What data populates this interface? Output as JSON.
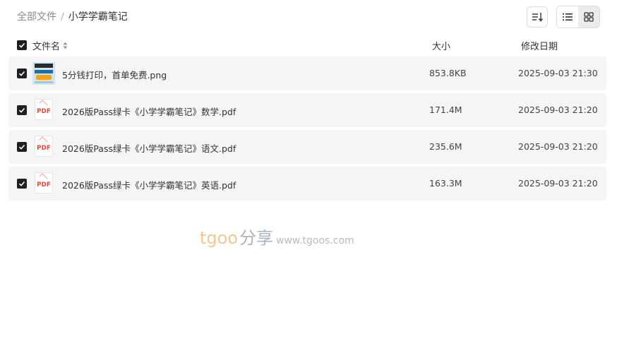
{
  "breadcrumb": {
    "root": "全部文件",
    "separator": "/",
    "current": "小学学霸笔记"
  },
  "toolbar": {
    "sort_icon": "sort-icon",
    "list_view_icon": "list-view-icon",
    "grid_view_icon": "grid-view-icon",
    "active_view": "list"
  },
  "table_header": {
    "name": "文件名",
    "size": "大小",
    "date": "修改日期"
  },
  "files": [
    {
      "name": "5分钱打印，首单免费.png",
      "size": "853.8KB",
      "date": "2025-09-03 21:30",
      "type": "image",
      "checked": true
    },
    {
      "name": "2026版Pass绿卡《小学学霸笔记》数学.pdf",
      "size": "171.4M",
      "date": "2025-09-03 21:20",
      "type": "pdf",
      "checked": true
    },
    {
      "name": "2026版Pass绿卡《小学学霸笔记》语文.pdf",
      "size": "235.6M",
      "date": "2025-09-03 21:20",
      "type": "pdf",
      "checked": true
    },
    {
      "name": "2026版Pass绿卡《小学学霸笔记》英语.pdf",
      "size": "163.3M",
      "date": "2025-09-03 21:20",
      "type": "pdf",
      "checked": true
    }
  ],
  "pdf_label": "PDF",
  "watermark": {
    "brand": "tgoo",
    "cn": "分享",
    "url": "www.tgoos.com"
  },
  "colors": {
    "row_bg": "#f5f5f5",
    "checkbox": "#1f1f1f",
    "pdf_red": "#e0453a",
    "watermark_orange": "#f2c796"
  }
}
